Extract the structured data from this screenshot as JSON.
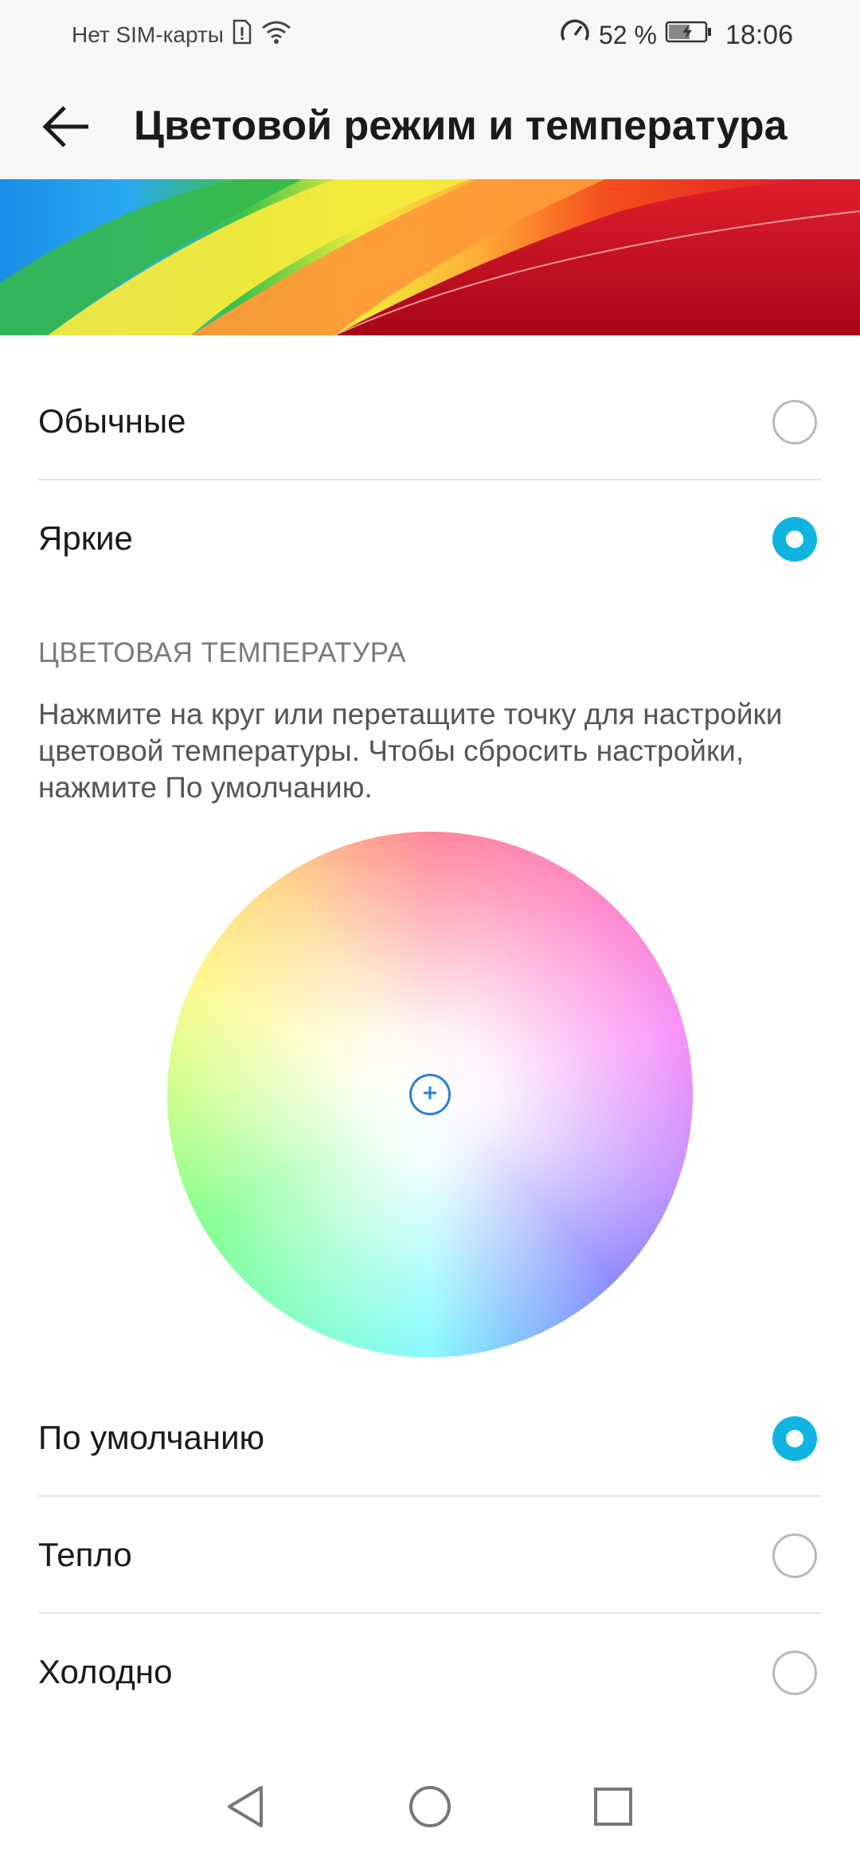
{
  "status_bar": {
    "carrier": "Нет SIM-карты",
    "battery_percent": "52 %",
    "time": "18:06",
    "icons": [
      "sim-alert-icon",
      "wifi-icon",
      "speedometer-icon",
      "battery-charging-icon"
    ]
  },
  "app_bar": {
    "title": "Цветовой режим и температура",
    "back_icon": "arrow-left-icon"
  },
  "color_mode": {
    "options": [
      {
        "label": "Обычные",
        "selected": false
      },
      {
        "label": "Яркие",
        "selected": true
      }
    ]
  },
  "color_temperature": {
    "section_title": "ЦВЕТОВАЯ ТЕМПЕРАТУРА",
    "description": "Нажмите на круг или перетащите точку для настройки цветовой температуры. Чтобы сбросить настройки, нажмите По умолчанию.",
    "options": [
      {
        "label": "По умолчанию",
        "selected": true
      },
      {
        "label": "Тепло",
        "selected": false
      },
      {
        "label": "Холодно",
        "selected": false
      }
    ]
  },
  "colors": {
    "accent": "#10b4e0",
    "wheel_point": "#2a7fd6"
  },
  "nav_bar": {
    "icons": [
      "nav-back-icon",
      "nav-home-icon",
      "nav-recents-icon"
    ]
  }
}
